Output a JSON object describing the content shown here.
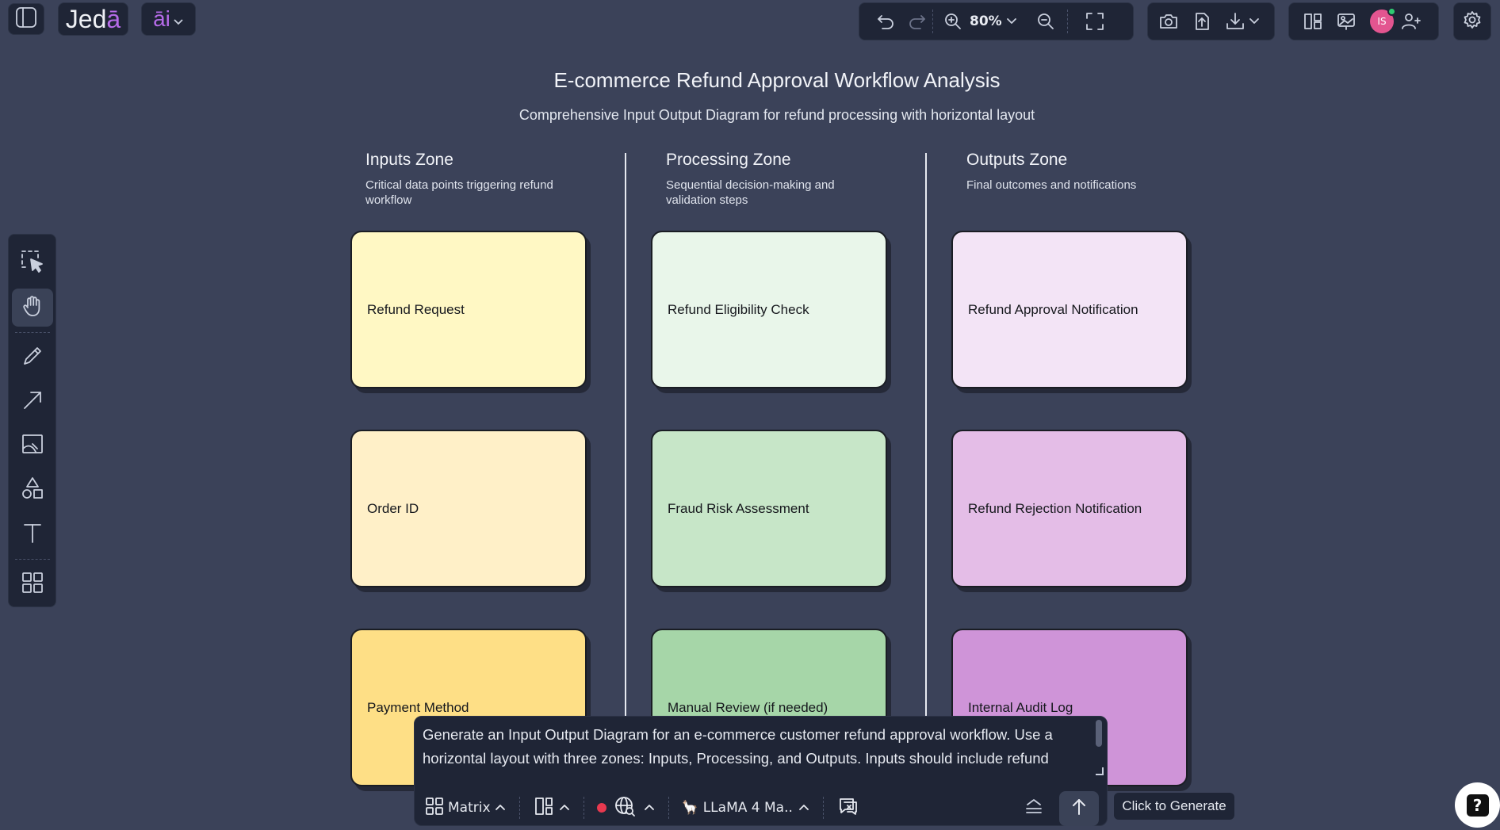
{
  "app": {
    "logo_text_main": "Jed",
    "logo_text_accent": "ā",
    "ai_label": "āi"
  },
  "toolbar": {
    "zoom_level": "80%"
  },
  "user": {
    "initials": "IS"
  },
  "canvas": {
    "title": "E-commerce Refund Approval Workflow Analysis",
    "subtitle": "Comprehensive Input Output Diagram for refund processing with horizontal layout",
    "zones": [
      {
        "title": "Inputs Zone",
        "description": "Critical data points triggering refund workflow",
        "cards": [
          {
            "label": "Refund Request",
            "color": "#fff8c4"
          },
          {
            "label": "Order ID",
            "color": "#fff0c8"
          },
          {
            "label": "Payment Method",
            "color": "#fedf86"
          }
        ]
      },
      {
        "title": "Processing Zone",
        "description": "Sequential decision-making and validation steps",
        "cards": [
          {
            "label": "Refund Eligibility Check",
            "color": "#e9f6ea"
          },
          {
            "label": "Fraud Risk Assessment",
            "color": "#c7e6c8"
          },
          {
            "label": "Manual Review (if needed)",
            "color": "#a6d6a8"
          }
        ]
      },
      {
        "title": "Outputs Zone",
        "description": "Final outcomes and notifications",
        "cards": [
          {
            "label": "Refund Approval Notification",
            "color": "#f3e4f6"
          },
          {
            "label": "Refund Rejection Notification",
            "color": "#e4bde7"
          },
          {
            "label": "Internal Audit Log",
            "color": "#cf94d8"
          }
        ]
      }
    ]
  },
  "prompt": {
    "text": "Generate an Input Output Diagram for an e-commerce customer refund approval workflow. Use a horizontal layout with three zones: Inputs, Processing, and Outputs. Inputs should include refund",
    "template_label": "Matrix",
    "model_label": "LLaMA 4 Ma..",
    "generate_tooltip": "Click to Generate"
  }
}
